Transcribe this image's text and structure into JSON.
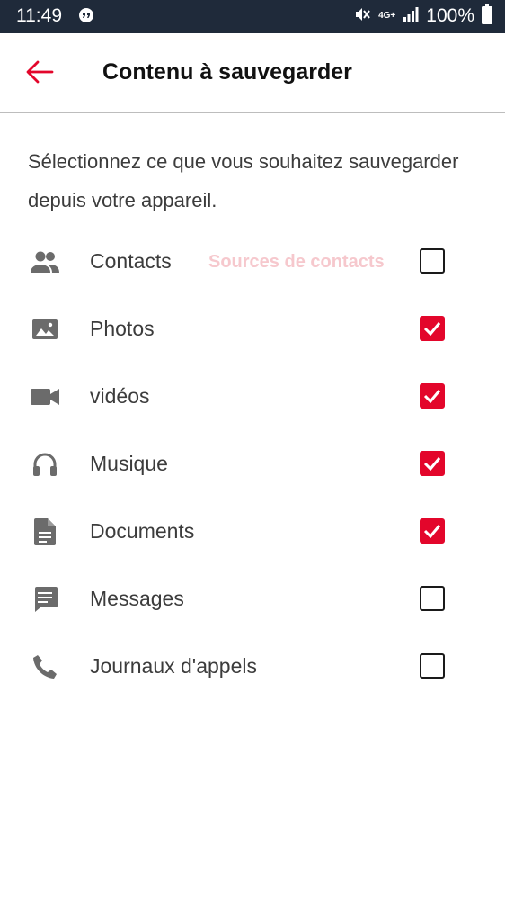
{
  "status_bar": {
    "time": "11:49",
    "network": "4G+",
    "battery": "100%"
  },
  "header": {
    "title": "Contenu à sauvegarder",
    "back_icon": "arrow-back-icon"
  },
  "intro_text": "Sélectionnez ce que vous souhaitez sauvegarder depuis votre appareil.",
  "items": [
    {
      "label": "Contacts",
      "icon": "contacts-icon",
      "link": "Sources de contacts",
      "checked": false
    },
    {
      "label": "Photos",
      "icon": "photo-icon",
      "checked": true
    },
    {
      "label": "vidéos",
      "icon": "video-camera-icon",
      "checked": true
    },
    {
      "label": "Musique",
      "icon": "headphones-icon",
      "checked": true
    },
    {
      "label": "Documents",
      "icon": "document-icon",
      "checked": true
    },
    {
      "label": "Messages",
      "icon": "message-icon",
      "checked": false
    },
    {
      "label": "Journaux d'appels",
      "icon": "phone-icon",
      "checked": false
    }
  ],
  "colors": {
    "accent": "#e3062b",
    "status_bar": "#1f2a3a",
    "link_disabled": "#f6c8cd",
    "icon": "#6b6b6b"
  }
}
